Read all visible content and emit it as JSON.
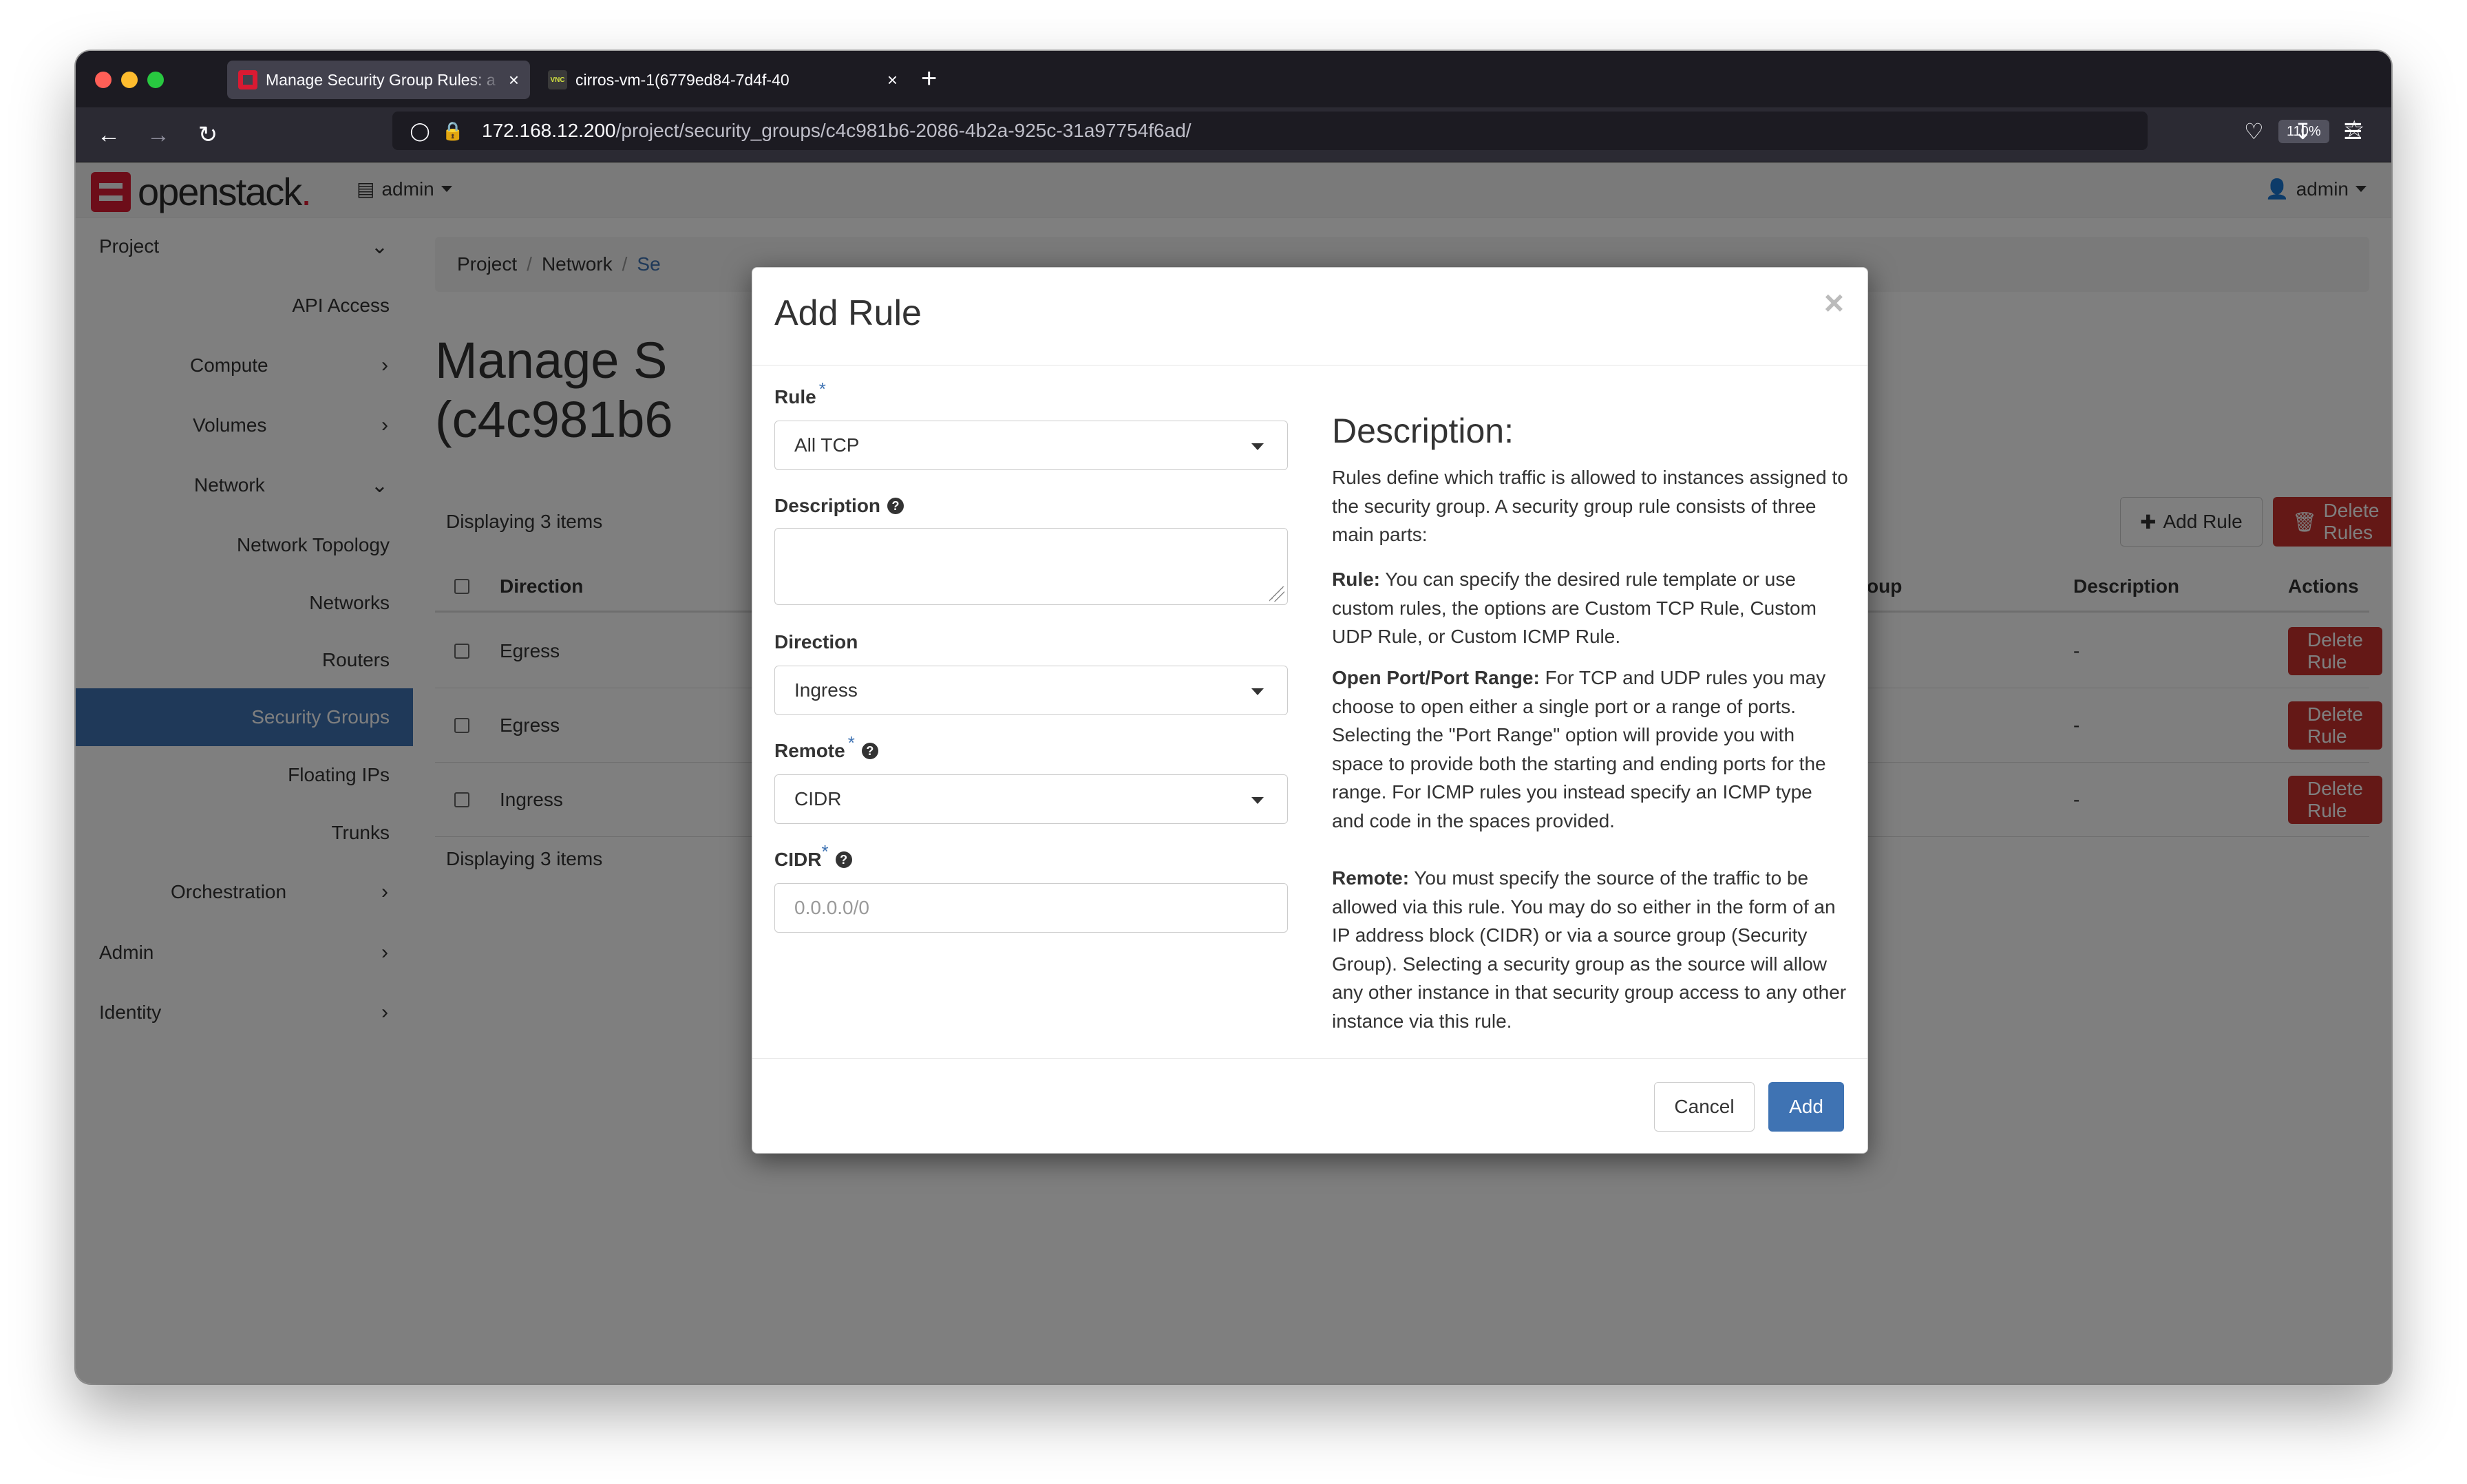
{
  "browser": {
    "tabs": [
      {
        "title": "Manage Security Group Rules: a",
        "active": true,
        "favicon": "openstack-icon"
      },
      {
        "title": "cirros-vm-1(6779ed84-7d4f-40",
        "active": false,
        "favicon": "vnc-icon",
        "favicon_text": "VNC"
      }
    ],
    "new_tab_label": "+",
    "close_glyph": "×",
    "url_host": "172.168.12.200",
    "url_path": "/project/security_groups/c4c981b6-2086-4b2a-925c-31a97754f6ad/",
    "zoom_level": "110%"
  },
  "header": {
    "logo_text": "openstack",
    "logo_dot": ".",
    "project_selector": "admin",
    "user_menu": "admin"
  },
  "sidebar": {
    "items": [
      {
        "label": "Project",
        "level": 0,
        "chevron": "down"
      },
      {
        "label": "API Access",
        "level": 2
      },
      {
        "label": "Compute",
        "level": 1,
        "chevron": "right"
      },
      {
        "label": "Volumes",
        "level": 1,
        "chevron": "right"
      },
      {
        "label": "Network",
        "level": 1,
        "chevron": "down"
      },
      {
        "label": "Network Topology",
        "level": 2
      },
      {
        "label": "Networks",
        "level": 2
      },
      {
        "label": "Routers",
        "level": 2
      },
      {
        "label": "Security Groups",
        "level": 2,
        "active": true
      },
      {
        "label": "Floating IPs",
        "level": 2
      },
      {
        "label": "Trunks",
        "level": 2
      },
      {
        "label": "Orchestration",
        "level": 1,
        "chevron": "right"
      },
      {
        "label": "Admin",
        "level": 0,
        "chevron": "right"
      },
      {
        "label": "Identity",
        "level": 0,
        "chevron": "right"
      }
    ]
  },
  "main": {
    "breadcrumb": [
      "Project",
      "Network",
      "Se"
    ],
    "title_line1": "Manage S",
    "title_line2": "(c4c981b6",
    "add_rule_label": "Add Rule",
    "delete_rules_label": "Delete Rules",
    "displaying_top": "Displaying 3 items",
    "displaying_bottom": "Displaying 3 items",
    "table": {
      "columns": [
        "Direction",
        "oup",
        "Description",
        "Actions"
      ],
      "rows": [
        {
          "direction": "Egress",
          "description": "-",
          "action": "Delete Rule"
        },
        {
          "direction": "Egress",
          "description": "-",
          "action": "Delete Rule"
        },
        {
          "direction": "Ingress",
          "description": "-",
          "action": "Delete Rule"
        }
      ]
    }
  },
  "modal": {
    "title": "Add Rule",
    "close_glyph": "×",
    "fields": {
      "rule": {
        "label": "Rule",
        "required": "*",
        "value": "All TCP"
      },
      "description": {
        "label": "Description",
        "value": ""
      },
      "direction": {
        "label": "Direction",
        "value": "Ingress"
      },
      "remote": {
        "label": "Remote",
        "required": "*",
        "value": "CIDR"
      },
      "cidr": {
        "label": "CIDR",
        "required": "*",
        "placeholder": "0.0.0.0/0",
        "value": ""
      }
    },
    "help_glyph": "?",
    "description_panel": {
      "heading": "Description:",
      "intro": "Rules define which traffic is allowed to instances assigned to the security group. A security group rule consists of three main parts:",
      "rule_term": "Rule:",
      "rule_text": " You can specify the desired rule template or use custom rules, the options are Custom TCP Rule, Custom UDP Rule, or Custom ICMP Rule.",
      "port_term": "Open Port/Port Range:",
      "port_text": " For TCP and UDP rules you may choose to open either a single port or a range of ports. Selecting the \"Port Range\" option will provide you with space to provide both the starting and ending ports for the range. For ICMP rules you instead specify an ICMP type and code in the spaces provided.",
      "remote_term": "Remote:",
      "remote_text": " You must specify the source of the traffic to be allowed via this rule. You may do so either in the form of an IP address block (CIDR) or via a source group (Security Group). Selecting a security group as the source will allow any other instance in that security group access to any other instance via this rule."
    },
    "cancel_label": "Cancel",
    "add_label": "Add"
  }
}
